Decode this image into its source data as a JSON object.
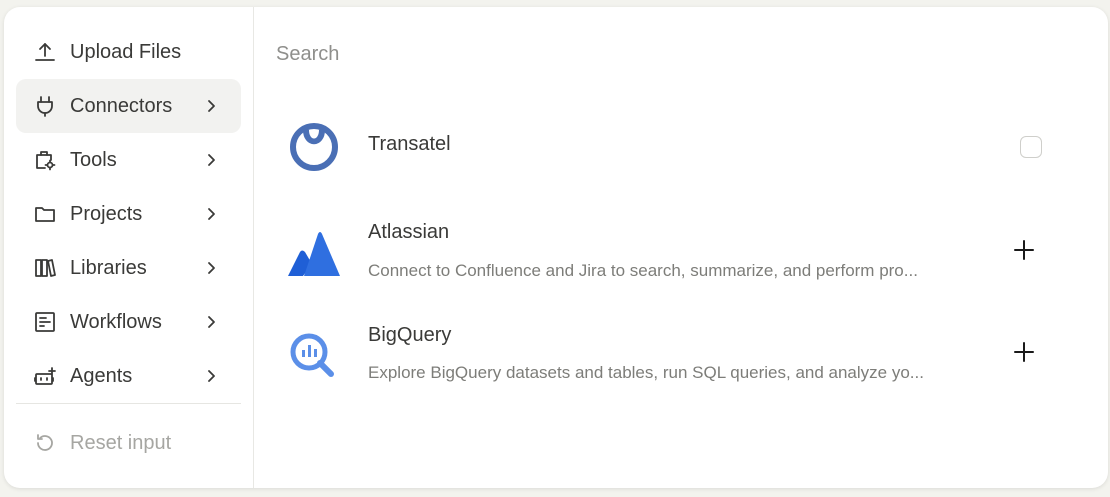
{
  "sidebar": {
    "items": [
      {
        "label": "Upload Files",
        "icon": "upload-icon",
        "has_chevron": false,
        "active": false
      },
      {
        "label": "Connectors",
        "icon": "plug-icon",
        "has_chevron": true,
        "active": true
      },
      {
        "label": "Tools",
        "icon": "tools-icon",
        "has_chevron": true,
        "active": false
      },
      {
        "label": "Projects",
        "icon": "folder-icon",
        "has_chevron": true,
        "active": false
      },
      {
        "label": "Libraries",
        "icon": "library-icon",
        "has_chevron": true,
        "active": false
      },
      {
        "label": "Workflows",
        "icon": "workflow-icon",
        "has_chevron": true,
        "active": false
      },
      {
        "label": "Agents",
        "icon": "agent-icon",
        "has_chevron": true,
        "active": false
      }
    ],
    "reset": {
      "label": "Reset input",
      "icon": "reset-icon",
      "disabled": true
    }
  },
  "search": {
    "placeholder": "Search",
    "value": ""
  },
  "connectors": [
    {
      "name": "Transatel",
      "description": "",
      "icon": "transatel-logo",
      "action": "checkbox",
      "checked": false
    },
    {
      "name": "Atlassian",
      "description": "Connect to Confluence and Jira to search, summarize, and perform pro...",
      "icon": "atlassian-logo",
      "action": "add"
    },
    {
      "name": "BigQuery",
      "description": "Explore BigQuery datasets and tables, run SQL queries, and analyze yo...",
      "icon": "bigquery-logo",
      "action": "add"
    }
  ],
  "colors": {
    "active_bg": "#f2f2f0",
    "text": "#3a3a38",
    "muted": "#7d7d79",
    "transatel_blue": "#4a6fb5",
    "atlassian_blue": "#2f6fe0",
    "bigquery_blue": "#5b8fe8"
  }
}
